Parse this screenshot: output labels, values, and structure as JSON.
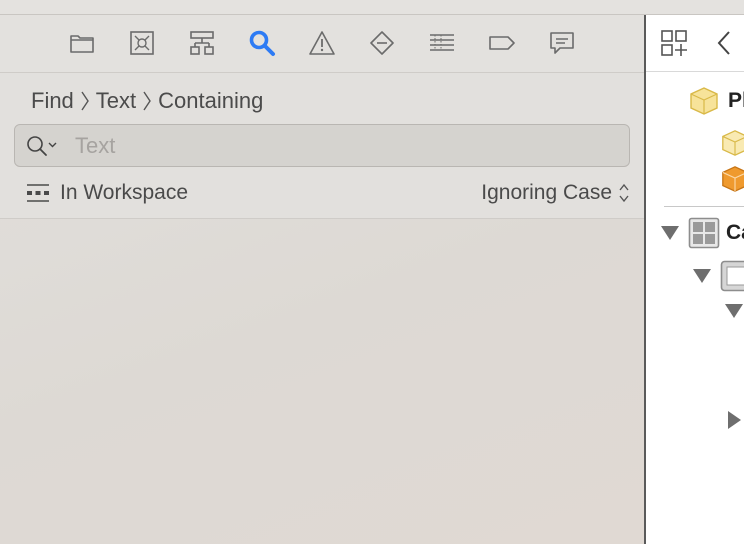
{
  "navigator": {
    "toolbar": {
      "icons": [
        "folder-icon",
        "source-control-icon",
        "hierarchy-icon",
        "search-icon",
        "warning-icon",
        "breakpoint-diamond-icon",
        "list-icon",
        "tag-icon",
        "comment-icon"
      ],
      "selected": "search-icon"
    },
    "find": {
      "breadcrumb": [
        "Find",
        "Text",
        "Containing"
      ],
      "search_placeholder": "Text",
      "search_value": "",
      "scope_label": "In Workspace",
      "case_option": "Ignoring Case"
    }
  },
  "outline": {
    "toolbar_icons": [
      "grid-icon",
      "chevron-left-icon"
    ],
    "rows": [
      {
        "label": "Pl",
        "icon": "project-cube-icon"
      },
      {
        "label": "",
        "icon": "cube-outline-icon"
      },
      {
        "label": "",
        "icon": "package-icon"
      },
      {
        "label": "Ca",
        "icon": "view-controller-icon",
        "disclosure": "expanded"
      },
      {
        "label": "",
        "icon": "view-icon",
        "disclosure": "expanded"
      },
      {
        "label": "",
        "icon": "",
        "disclosure": "expanded"
      },
      {
        "label": "",
        "icon": "",
        "disclosure": "collapsed"
      }
    ]
  },
  "colors": {
    "accent": "#2d7bf4",
    "icon_gray": "#6b6b6b",
    "project_yellow": "#f2cf5b",
    "package_orange": "#ef9a2e"
  }
}
